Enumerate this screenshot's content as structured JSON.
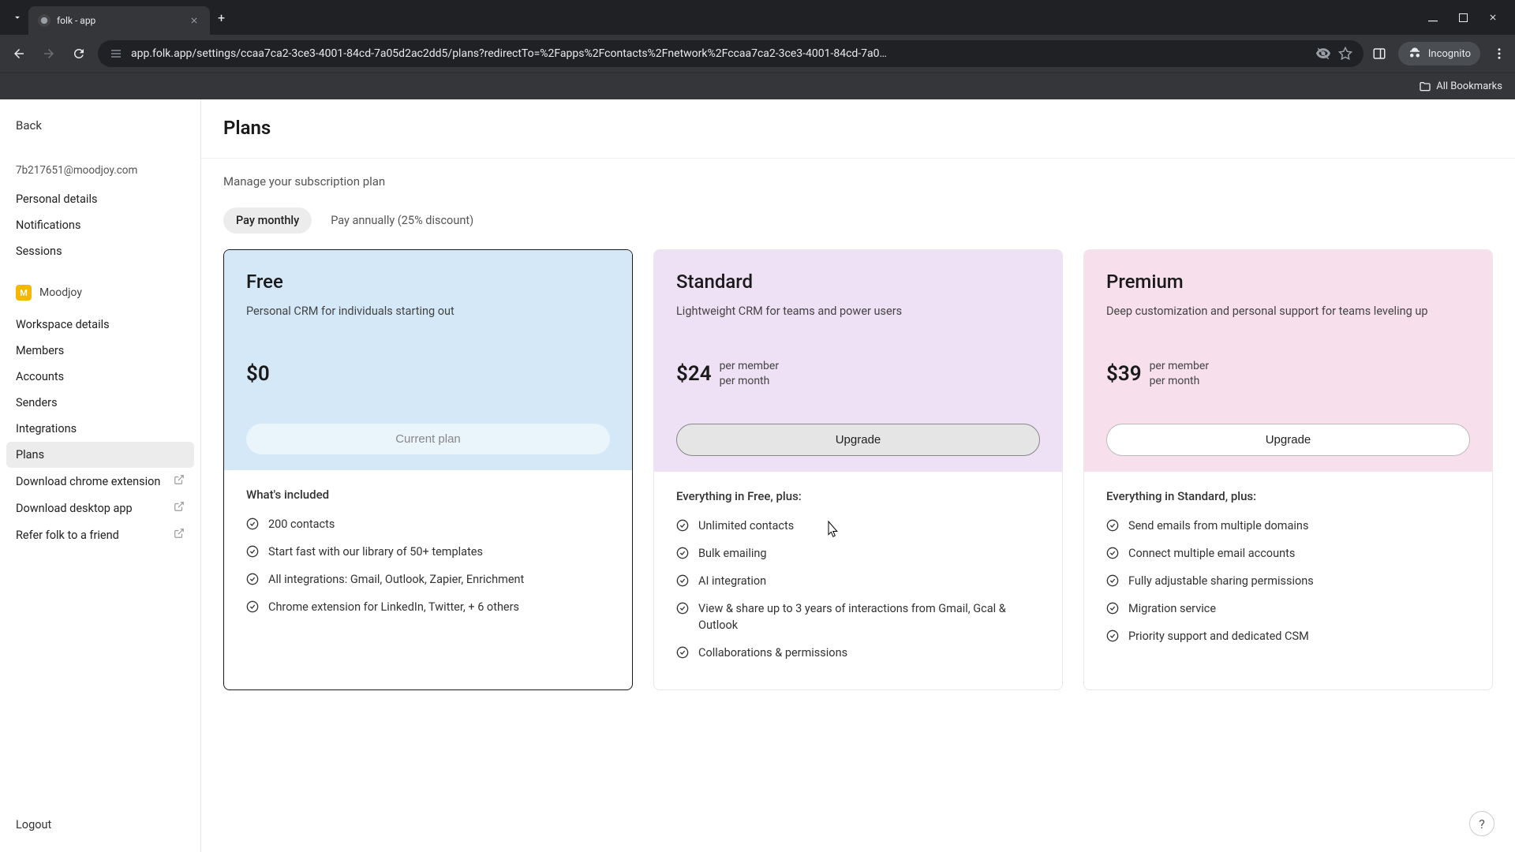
{
  "browser": {
    "tab_title": "folk - app",
    "url": "app.folk.app/settings/ccaa7ca2-3ce3-4001-84cd-7a05d2ac2dd5/plans?redirectTo=%2Fapps%2Fcontacts%2Fnetwork%2Fccaa7ca2-3ce3-4001-84cd-7a0…",
    "incognito_label": "Incognito",
    "all_bookmarks": "All Bookmarks"
  },
  "sidebar": {
    "back": "Back",
    "email": "7b217651@moodjoy.com",
    "items_personal": [
      "Personal details",
      "Notifications",
      "Sessions"
    ],
    "workspace": {
      "badge": "M",
      "name": "Moodjoy"
    },
    "items_workspace": [
      "Workspace details",
      "Members",
      "Accounts",
      "Senders",
      "Integrations",
      "Plans",
      "Download chrome extension",
      "Download desktop app",
      "Refer folk to a friend"
    ],
    "active": "Plans",
    "logout": "Logout"
  },
  "page": {
    "title": "Plans",
    "subtitle": "Manage your subscription plan",
    "toggle": {
      "monthly": "Pay monthly",
      "annually": "Pay annually (25% discount)"
    }
  },
  "plans": [
    {
      "name": "Free",
      "desc": "Personal CRM for individuals starting out",
      "price": "$0",
      "unit": "",
      "cta": "Current plan",
      "cta_type": "current",
      "body_title": "What's included",
      "features": [
        "200 contacts",
        "Start fast with our library of 50+ templates",
        "All integrations: Gmail, Outlook, Zapier, Enrichment",
        "Chrome extension for LinkedIn, Twitter, + 6 others"
      ],
      "header_class": "free",
      "current": true
    },
    {
      "name": "Standard",
      "desc": "Lightweight CRM for teams and power users",
      "price": "$24",
      "unit": "per member\nper month",
      "cta": "Upgrade",
      "cta_type": "upgrade hover",
      "body_title": "Everything in Free, plus:",
      "features": [
        "Unlimited contacts",
        "Bulk emailing",
        "AI integration",
        "View & share up to 3 years of interactions from Gmail, Gcal & Outlook",
        "Collaborations & permissions"
      ],
      "header_class": "standard",
      "current": false
    },
    {
      "name": "Premium",
      "desc": "Deep customization and personal support for teams leveling up",
      "price": "$39",
      "unit": "per member\nper month",
      "cta": "Upgrade",
      "cta_type": "upgrade",
      "body_title": "Everything in Standard, plus:",
      "features": [
        "Send emails from multiple domains",
        "Connect multiple email accounts",
        "Fully adjustable sharing permissions",
        "Migration service",
        "Priority support and dedicated CSM"
      ],
      "header_class": "premium",
      "current": false
    }
  ]
}
